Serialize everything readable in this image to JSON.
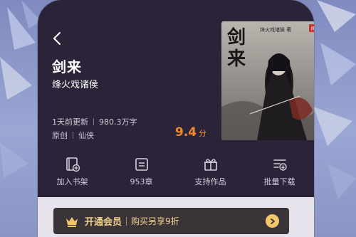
{
  "book": {
    "title": "剑来",
    "author": "烽火戏诸侯",
    "updated": "1天前更新",
    "word_count": "980.3万字",
    "origin": "原创",
    "genre": "仙侠",
    "score": "9.4",
    "score_unit": "分",
    "cover": {
      "title_text": "剑来",
      "author_text": "烽火戏诸侯 著",
      "badge": "阅文"
    }
  },
  "actions": [
    {
      "label": "加入书架",
      "icon": "bookshelf-add-icon"
    },
    {
      "label": "953章",
      "icon": "chapter-list-icon"
    },
    {
      "label": "支持作品",
      "icon": "gift-icon"
    },
    {
      "label": "批量下载",
      "icon": "batch-download-icon"
    }
  ],
  "vip": {
    "title": "开通会员",
    "subtitle": "购买另享9折",
    "icon": "crown-icon"
  },
  "colors": {
    "panel": "#2b2438",
    "score": "#f08a2e",
    "vip_gold": "#f2d18a"
  }
}
